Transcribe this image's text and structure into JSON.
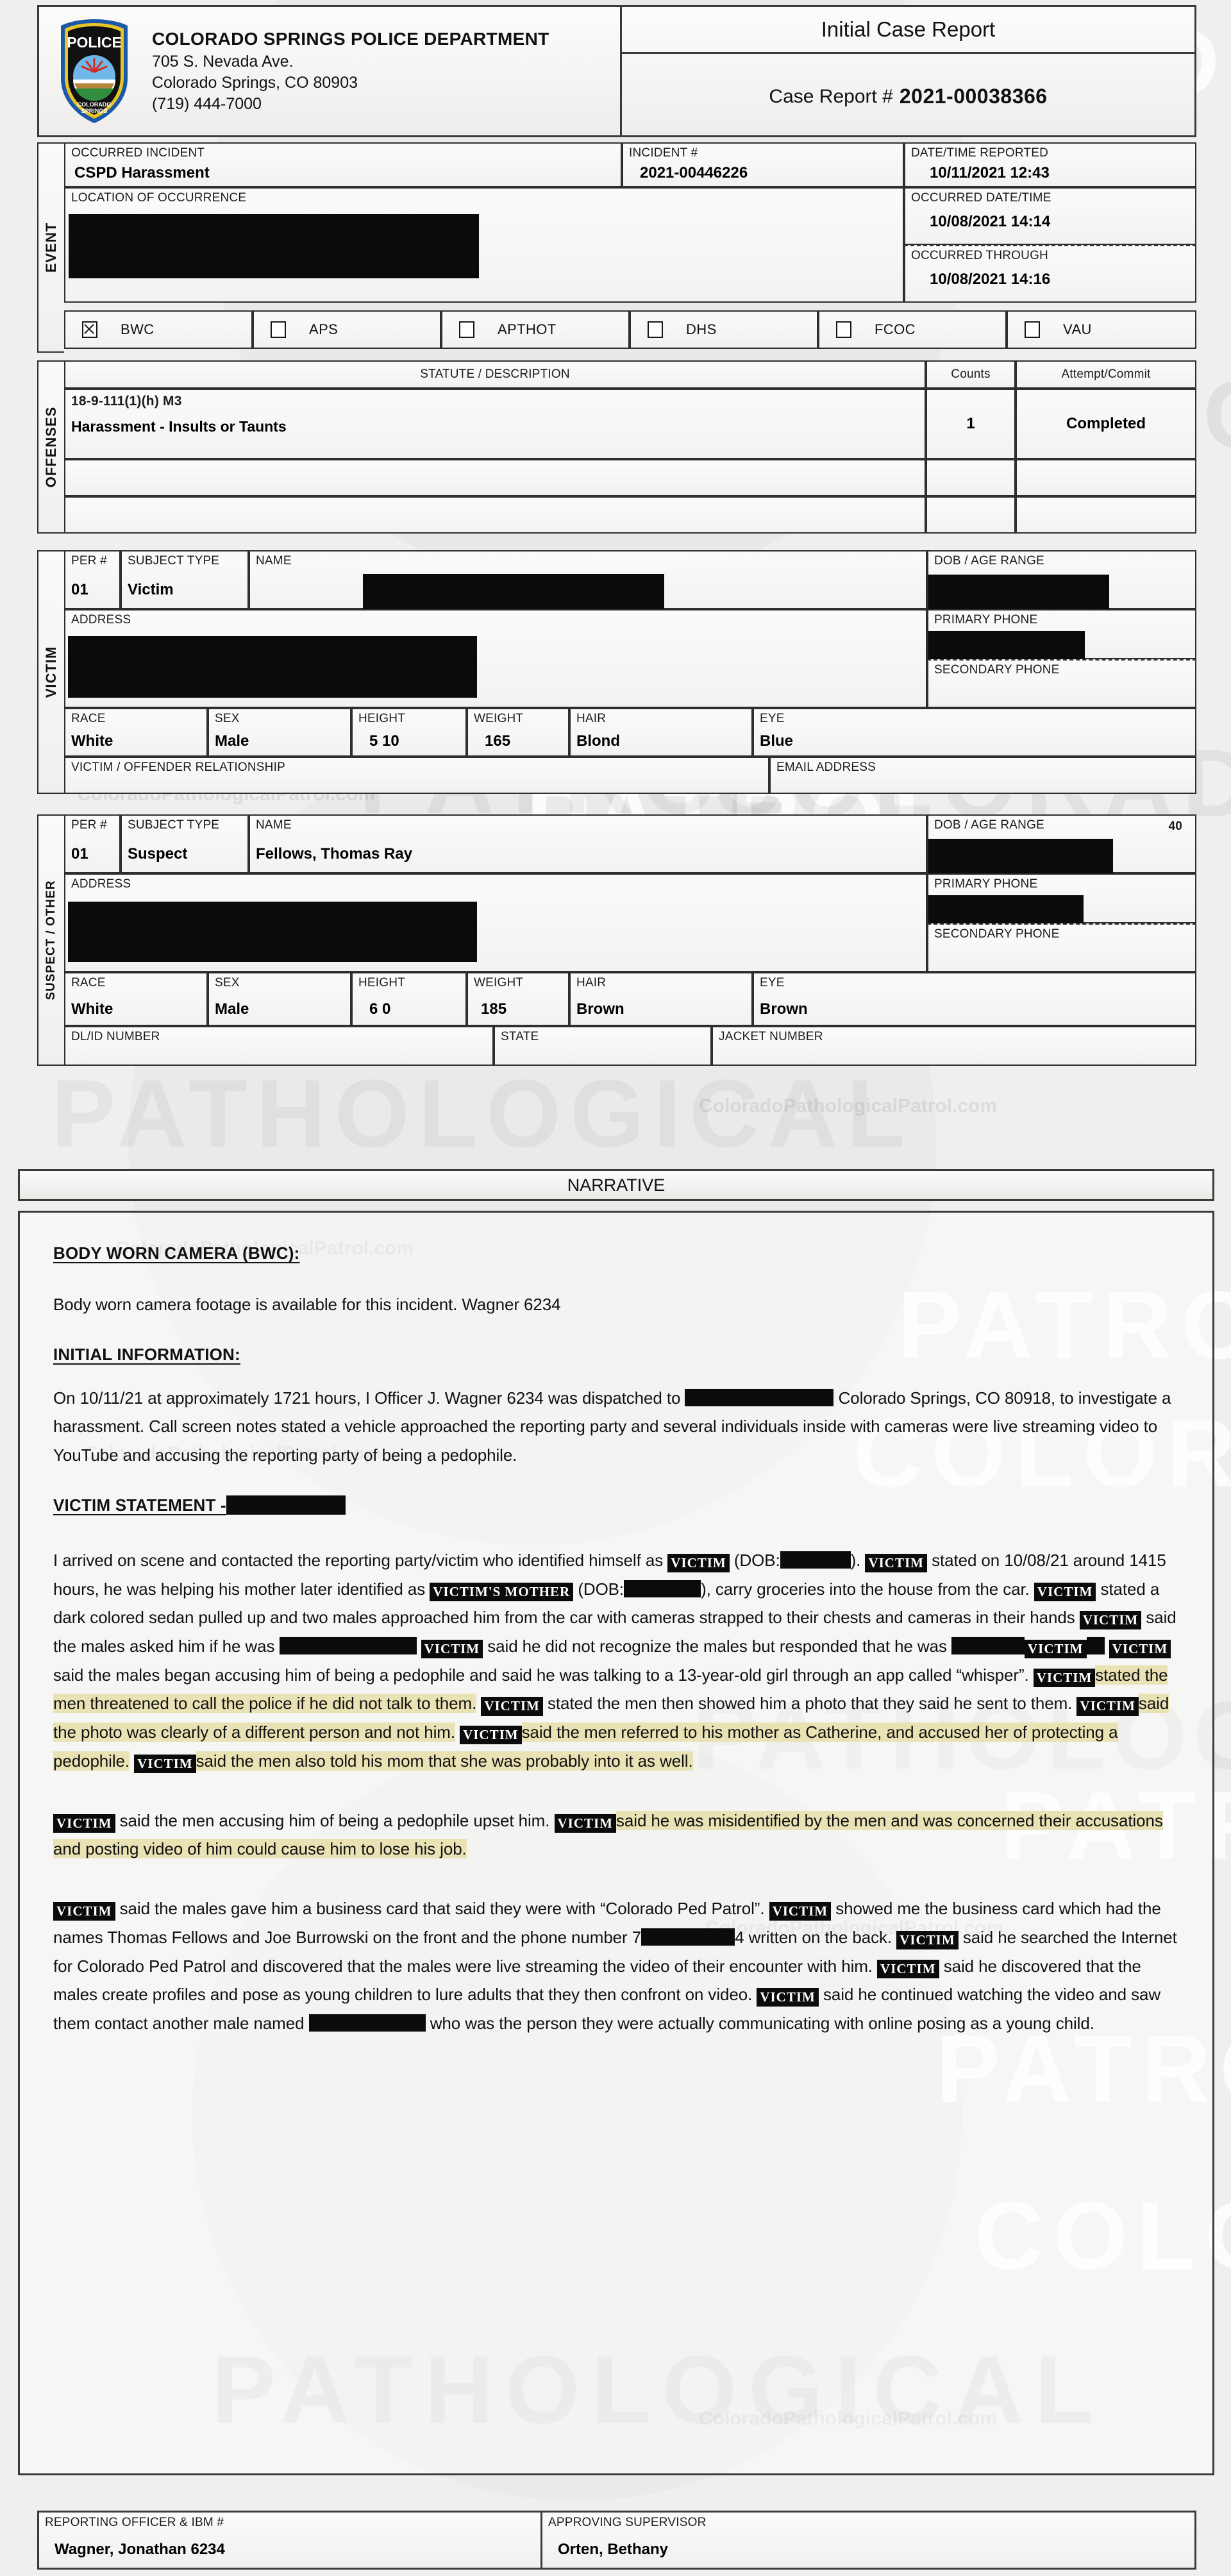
{
  "header": {
    "department_name": "COLORADO SPRINGS POLICE DEPARTMENT",
    "address_line1": "705 S. Nevada Ave.",
    "address_line2": "Colorado Springs, CO 80903",
    "phone": "(719) 444-7000",
    "report_title": "Initial Case Report",
    "case_report_label": "Case Report #",
    "case_report_number": "2021-00038366",
    "badge_text": "POLICE"
  },
  "event": {
    "section_label": "EVENT",
    "occurred_incident_label": "OCCURRED INCIDENT",
    "occurred_incident_value": "CSPD Harassment",
    "location_label": "LOCATION OF OCCURRENCE",
    "location_value": "",
    "incident_number_label": "INCIDENT #",
    "incident_number_value": "2021-00446226",
    "date_reported_label": "DATE/TIME REPORTED",
    "date_reported_value": "10/11/2021  12:43",
    "occurred_datetime_label": "OCCURRED DATE/TIME",
    "occurred_datetime_value": "10/08/2021  14:14",
    "occurred_through_label": "OCCURRED THROUGH",
    "occurred_through_value": "10/08/2021  14:16",
    "checkboxes": [
      {
        "label": "BWC",
        "checked": true
      },
      {
        "label": "APS",
        "checked": false
      },
      {
        "label": "APTHOT",
        "checked": false
      },
      {
        "label": "DHS",
        "checked": false
      },
      {
        "label": "FCOC",
        "checked": false
      },
      {
        "label": "VAU",
        "checked": false
      }
    ]
  },
  "offenses": {
    "section_label": "OFFENSES",
    "col_statute": "STATUTE / DESCRIPTION",
    "col_counts": "Counts",
    "col_attempt": "Attempt/Commit",
    "rows": [
      {
        "statute": "18-9-111(1)(h) M3",
        "description": "Harassment - Insults or Taunts",
        "counts": "1",
        "attempt_commit": "Completed"
      },
      {
        "statute": "",
        "description": "",
        "counts": "",
        "attempt_commit": ""
      },
      {
        "statute": "",
        "description": "",
        "counts": "",
        "attempt_commit": ""
      }
    ]
  },
  "victim": {
    "section_label": "VICTIM",
    "per_label": "PER #",
    "per_value": "01",
    "subject_type_label": "SUBJECT TYPE",
    "subject_type_value": "Victim",
    "name_label": "NAME",
    "name_value": "",
    "dob_label": "DOB / AGE RANGE",
    "dob_value": "",
    "address_label": "ADDRESS",
    "address_value": "",
    "primary_phone_label": "PRIMARY PHONE",
    "primary_phone_value": "",
    "secondary_phone_label": "SECONDARY PHONE",
    "secondary_phone_value": "",
    "race_label": "RACE",
    "race_value": "White",
    "sex_label": "SEX",
    "sex_value": "Male",
    "height_label": "HEIGHT",
    "height_value": "5 10",
    "weight_label": "WEIGHT",
    "weight_value": "165",
    "hair_label": "HAIR",
    "hair_value": "Blond",
    "eye_label": "EYE",
    "eye_value": "Blue",
    "relationship_label": "VICTIM / OFFENDER RELATIONSHIP",
    "relationship_value": "",
    "email_label": "EMAIL ADDRESS",
    "email_value": ""
  },
  "suspect": {
    "section_label": "SUSPECT / OTHER",
    "per_label": "PER #",
    "per_value": "01",
    "subject_type_label": "SUBJECT TYPE",
    "subject_type_value": "Suspect",
    "name_label": "NAME",
    "name_value": "Fellows, Thomas Ray",
    "dob_label": "DOB / AGE RANGE",
    "dob_age": "40",
    "dob_value": "",
    "address_label": "ADDRESS",
    "address_value": "",
    "primary_phone_label": "PRIMARY PHONE",
    "primary_phone_value": "",
    "secondary_phone_label": "SECONDARY PHONE",
    "secondary_phone_value": "",
    "race_label": "RACE",
    "race_value": "White",
    "sex_label": "SEX",
    "sex_value": "Male",
    "height_label": "HEIGHT",
    "height_value": "6 0",
    "weight_label": "WEIGHT",
    "weight_value": "185",
    "hair_label": "HAIR",
    "hair_value": "Brown",
    "eye_label": "EYE",
    "eye_value": "Brown",
    "dlid_label": "DL/ID NUMBER",
    "dlid_value": "",
    "state_label": "STATE",
    "state_value": "",
    "jacket_label": "JACKET NUMBER",
    "jacket_value": ""
  },
  "narrative": {
    "section_header": "NARRATIVE",
    "bwc_heading": "BODY WORN CAMERA (BWC):",
    "bwc_text": "Body worn camera footage is available for this incident. Wagner 6234",
    "initial_info_heading": "INITIAL INFORMATION:",
    "initial_info_text_a": "On 10/11/21 at approximately 1721 hours, I Officer J. Wagner 6234 was dispatched to",
    "initial_info_text_b": "Colorado Springs, CO 80918, to investigate a harassment. Call screen notes stated a vehicle approached the reporting party and several individuals inside with cameras were live streaming video to YouTube and accusing the reporting party of being a pedophile.",
    "victim_statement_heading": "VICTIM STATEMENT -",
    "redaction_token": "VICTIM",
    "redaction_token_mother": "VICTIM'S MOTHER",
    "p1_a": "I arrived on scene and contacted the reporting party/victim who identified himself as",
    "p1_b": "(DOB:",
    "p1_c": ").",
    "p1_d": "stated on 10/08/21 around 1415 hours, he was helping his mother later identified as",
    "p1_e": "(DOB:",
    "p1_f": "), carry groceries into the house from the car.",
    "p1_g": "stated a dark colored sedan pulled up and two males approached him from the car with cameras strapped to their chests and cameras in their hands",
    "p1_h": "said the males asked him if he was",
    "p1_i": "said he did not recognize the males but responded that he was",
    "p1_j": "said the males began accusing him of being a pedophile and said he was talking to a 13-year-old girl through an app called “whisper”.",
    "p1_k": "stated the men threatened to call the police if he did not talk to them.",
    "p1_l": "stated the men then showed him a photo that they said he sent to them.",
    "p1_m": "said the photo was clearly of a different person and not him.",
    "p1_n": "said the men referred to his mother as Catherine, and accused her of protecting a pedophile.",
    "p1_o": "said the men also told his mom that she was probably into it as well.",
    "p2_a": "said the men accusing him of being a pedophile upset him.",
    "p2_b": "said he was misidentified by the men and was concerned their accusations and posting video of him could cause him to lose his job.",
    "p3_a": "said the males gave him a business card that said they were with “Colorado Ped Patrol”.",
    "p3_b": "showed me the business card which had the names Thomas Fellows and Joe Burrowski on the front and the phone number 7",
    "p3_c": "4 written on the back.",
    "p3_d": "said he searched the Internet for Colorado Ped Patrol and discovered that the males were live streaming the video of their encounter with him.",
    "p3_e": "said he discovered that the males create profiles and pose as young children to lure adults that they then confront on video.",
    "p3_f": "said he continued watching the video and saw them contact another male named",
    "p3_g": "who was the person they were actually communicating with online posing as a young child."
  },
  "footer": {
    "reporting_officer_label": "REPORTING OFFICER & IBM #",
    "reporting_officer_value": "Wagner, Jonathan 6234",
    "approving_supervisor_label": "APPROVING SUPERVISOR",
    "approving_supervisor_value": "Orten, Bethany"
  },
  "watermarks": {
    "url": "ColoradoPathologicalPatrol.com",
    "word_colorado": "COLORADO",
    "word_patrol": "PATROL",
    "word_pathological": "PATHOLOGICAL"
  },
  "colors": {
    "highlight": "#e9e2b4",
    "redaction": "#0b0b0b",
    "page_bg": "#f0efed",
    "border": "#2e2e2e"
  }
}
